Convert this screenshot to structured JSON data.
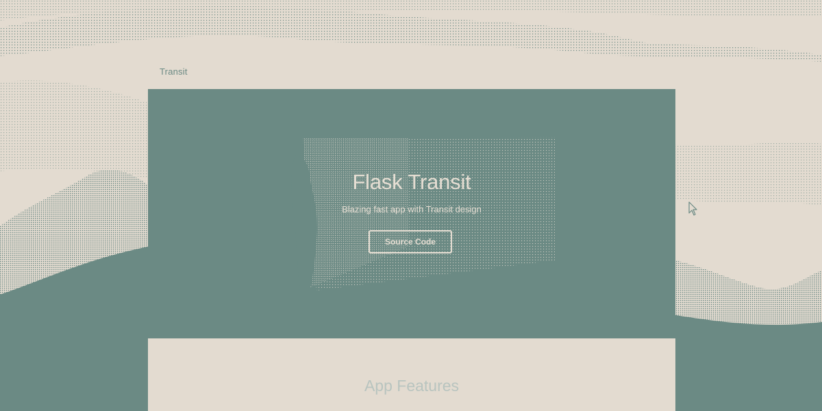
{
  "navbar": {
    "brand": "Transit"
  },
  "hero": {
    "title": "Flask Transit",
    "subtitle": "Blazing fast app with Transit design",
    "button_label": "Source Code"
  },
  "features": {
    "heading": "App Features"
  },
  "colors": {
    "background": "#e3dbd0",
    "accent": "#6b8a84",
    "hero_text": "#e6ded3",
    "muted_heading": "#b8c4bf"
  },
  "icons": {
    "cursor": "mouse-pointer-icon"
  }
}
